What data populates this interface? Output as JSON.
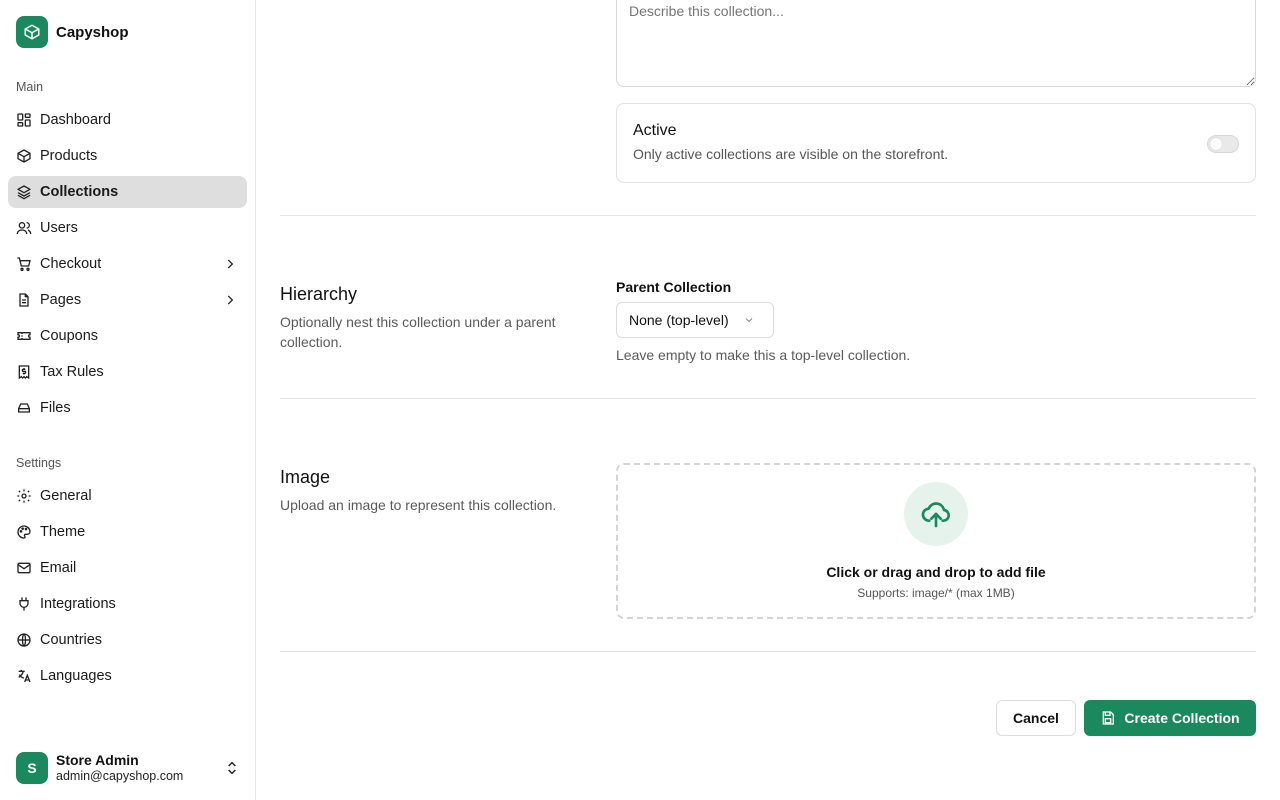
{
  "brand": {
    "name": "Capyshop",
    "logo_icon": "package-icon",
    "color": "#1a8a5e"
  },
  "sidebar": {
    "main_label": "Main",
    "main_items": [
      {
        "label": "Dashboard",
        "icon": "dashboard-icon"
      },
      {
        "label": "Products",
        "icon": "package-icon"
      },
      {
        "label": "Collections",
        "icon": "layers-icon",
        "active": true
      },
      {
        "label": "Users",
        "icon": "users-icon"
      },
      {
        "label": "Checkout",
        "icon": "cart-icon",
        "expandable": true
      },
      {
        "label": "Pages",
        "icon": "file-icon",
        "expandable": true
      },
      {
        "label": "Coupons",
        "icon": "ticket-icon"
      },
      {
        "label": "Tax Rules",
        "icon": "receipt-icon"
      },
      {
        "label": "Files",
        "icon": "drive-icon"
      }
    ],
    "settings_label": "Settings",
    "settings_items": [
      {
        "label": "General",
        "icon": "gear-icon"
      },
      {
        "label": "Theme",
        "icon": "palette-icon"
      },
      {
        "label": "Email",
        "icon": "mail-icon"
      },
      {
        "label": "Integrations",
        "icon": "plug-icon"
      },
      {
        "label": "Countries",
        "icon": "globe-icon"
      },
      {
        "label": "Languages",
        "icon": "translate-icon"
      }
    ]
  },
  "user": {
    "initial": "S",
    "name": "Store Admin",
    "email": "admin@capyshop.com"
  },
  "form": {
    "description_placeholder": "Describe this collection...",
    "active": {
      "title": "Active",
      "description": "Only active collections are visible on the storefront.",
      "enabled": false
    },
    "hierarchy": {
      "title": "Hierarchy",
      "description": "Optionally nest this collection under a parent collection.",
      "field_label": "Parent Collection",
      "selected": "None (top-level)",
      "help": "Leave empty to make this a top-level collection."
    },
    "image": {
      "title": "Image",
      "description": "Upload an image to represent this collection.",
      "dropzone_title": "Click or drag and drop to add file",
      "dropzone_sub": "Supports: image/* (max 1MB)"
    },
    "actions": {
      "cancel": "Cancel",
      "create": "Create Collection"
    }
  }
}
